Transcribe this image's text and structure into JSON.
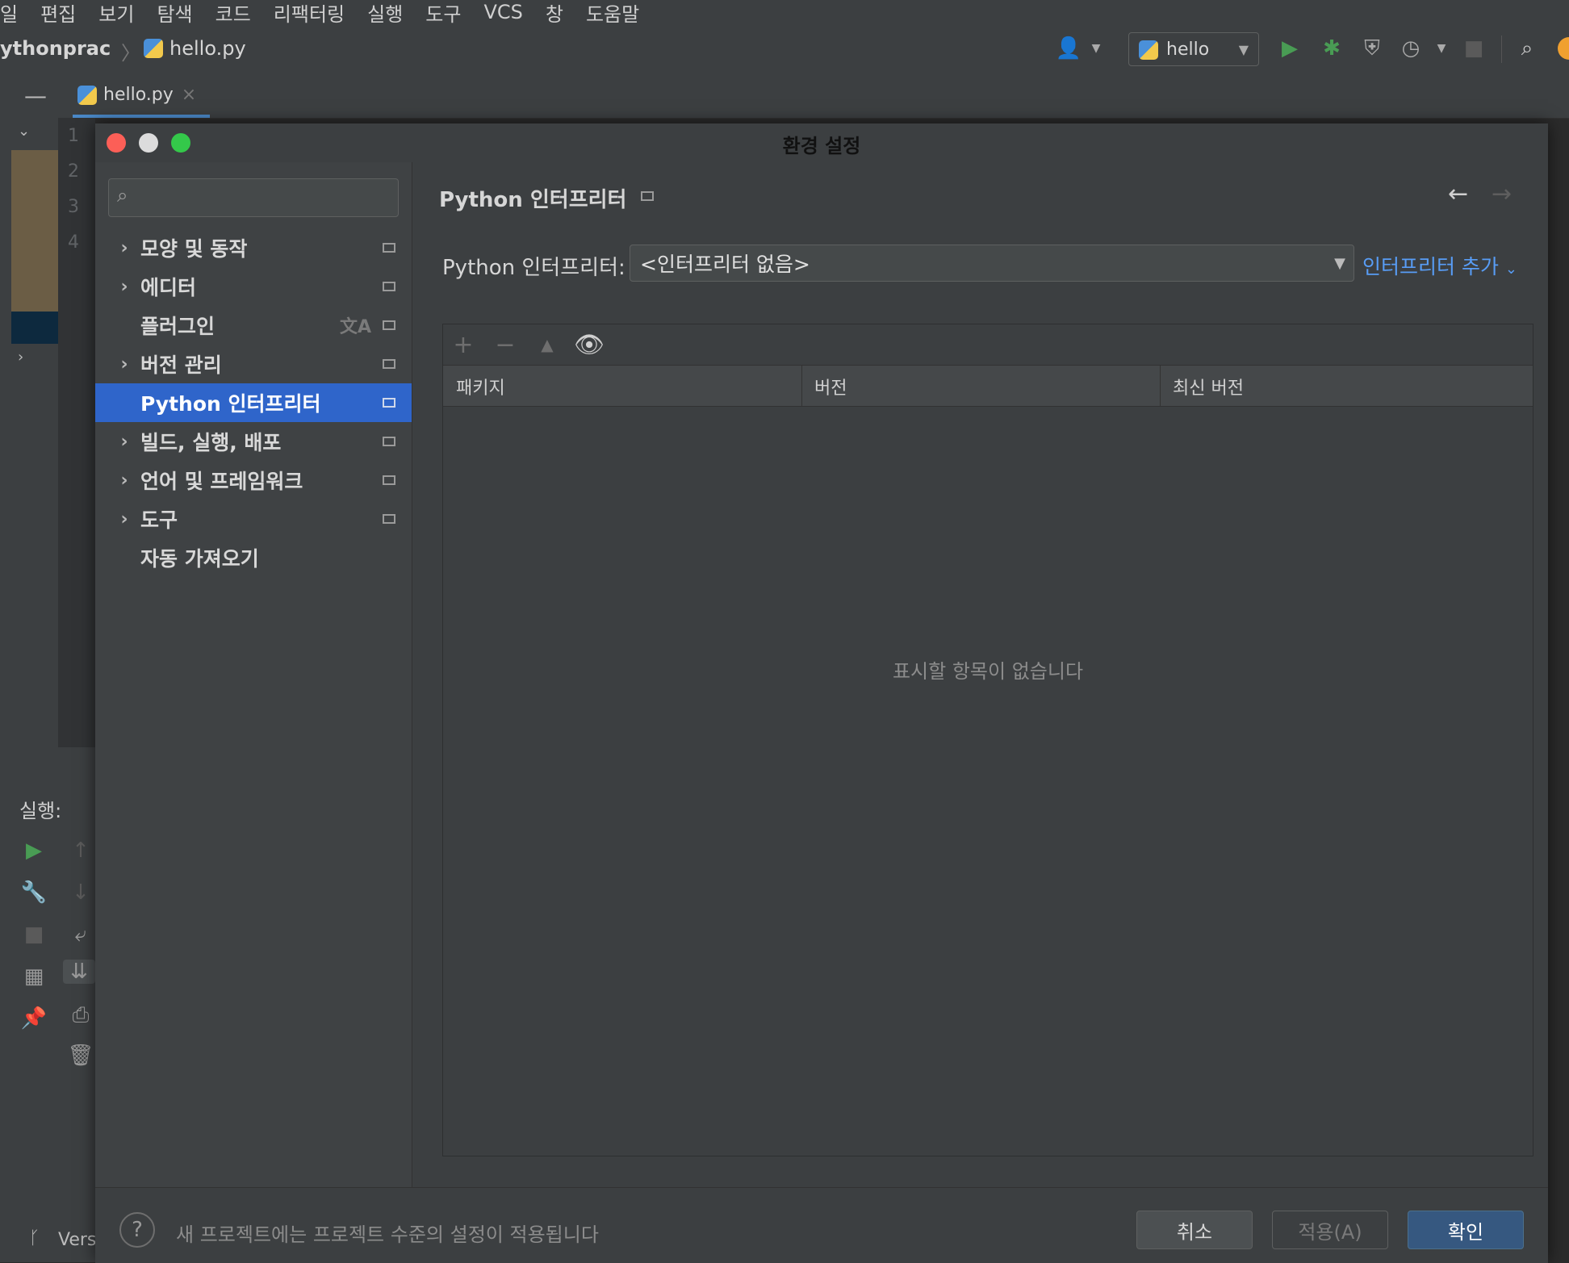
{
  "menu": [
    "일",
    "편집",
    "보기",
    "탐색",
    "코드",
    "리팩터링",
    "실행",
    "도구",
    "VCS",
    "창",
    "도움말"
  ],
  "breadcrumb": {
    "project": "ythonprac",
    "file": "hello.py"
  },
  "run_config": "hello",
  "editor_tab": {
    "label": "hello.py",
    "close": "×"
  },
  "line_numbers": [
    "1",
    "2",
    "3",
    "4"
  ],
  "run_panel": {
    "label": "실행:",
    "vcs_label": "Vers"
  },
  "dialog": {
    "title": "환경 설정",
    "search_placeholder": "",
    "nav": [
      {
        "label": "모양 및 동작",
        "expandable": true,
        "selected": false
      },
      {
        "label": "에디터",
        "expandable": true,
        "selected": false
      },
      {
        "label": "플러그인",
        "expandable": false,
        "selected": false
      },
      {
        "label": "버전 관리",
        "expandable": true,
        "selected": false
      },
      {
        "label": "Python 인터프리터",
        "expandable": false,
        "selected": true
      },
      {
        "label": "빌드, 실행, 배포",
        "expandable": true,
        "selected": false
      },
      {
        "label": "언어 및 프레임워크",
        "expandable": true,
        "selected": false
      },
      {
        "label": "도구",
        "expandable": true,
        "selected": false
      },
      {
        "label": "자동 가져오기",
        "expandable": false,
        "selected": false
      }
    ],
    "panel_title": "Python 인터프리터",
    "interpreter_label": "Python 인터프리터:",
    "interpreter_value": "<인터프리터 없음>",
    "add_interpreter": "인터프리터 추가",
    "table": {
      "columns": [
        "패키지",
        "버전",
        "최신 버전"
      ],
      "empty_text": "표시할 항목이 없습니다"
    },
    "footer_note": "새 프로젝트에는 프로젝트 수준의 설정이 적용됩니다",
    "buttons": {
      "cancel": "취소",
      "apply": "적용(A)",
      "ok": "확인"
    }
  },
  "colors": {
    "accent": "#2f65ca",
    "link": "#589df6",
    "run_green": "#499c54"
  }
}
